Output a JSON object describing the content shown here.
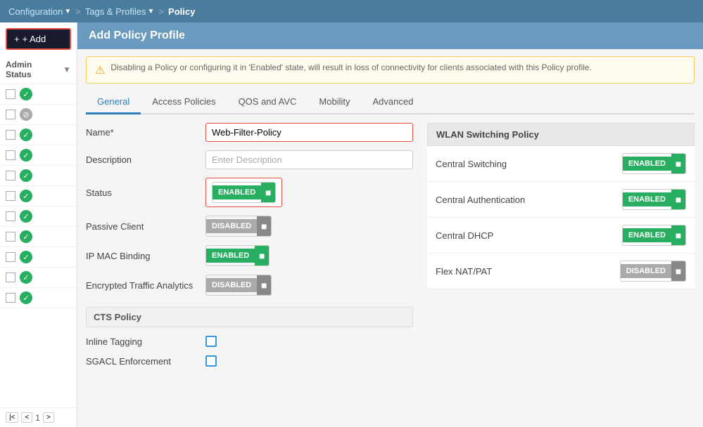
{
  "nav": {
    "config_label": "Configuration",
    "separator1": ">",
    "tags_label": "Tags & Profiles",
    "separator2": ">",
    "current": "Policy"
  },
  "sidebar": {
    "add_button": "+ Add",
    "admin_status_label": "Admin Status",
    "page_number": "1",
    "rows": [
      {
        "status": "green"
      },
      {
        "status": "grey"
      },
      {
        "status": "green"
      },
      {
        "status": "green"
      },
      {
        "status": "green"
      },
      {
        "status": "green"
      },
      {
        "status": "green"
      },
      {
        "status": "green"
      },
      {
        "status": "green"
      },
      {
        "status": "green"
      },
      {
        "status": "green"
      }
    ]
  },
  "content": {
    "header_title": "Add Policy Profile",
    "warning_text": "Disabling a Policy or configuring it in 'Enabled' state, will result in loss of connectivity for clients associated with this Policy profile.",
    "tabs": [
      {
        "label": "General",
        "active": true
      },
      {
        "label": "Access Policies",
        "active": false
      },
      {
        "label": "QOS and AVC",
        "active": false
      },
      {
        "label": "Mobility",
        "active": false
      },
      {
        "label": "Advanced",
        "active": false
      }
    ],
    "form": {
      "name_label": "Name*",
      "name_value": "Web-Filter-Policy",
      "description_label": "Description",
      "description_placeholder": "Enter Description",
      "status_label": "Status",
      "status_value": "ENABLED",
      "passive_client_label": "Passive Client",
      "passive_client_value": "DISABLED",
      "ip_mac_label": "IP MAC Binding",
      "ip_mac_value": "ENABLED",
      "encrypted_label": "Encrypted Traffic Analytics",
      "encrypted_value": "DISABLED",
      "cts_section_label": "CTS Policy",
      "inline_tagging_label": "Inline Tagging",
      "sgacl_label": "SGACL Enforcement"
    },
    "right_panel": {
      "title": "WLAN Switching Policy",
      "central_switching_label": "Central Switching",
      "central_switching_value": "ENABLED",
      "central_auth_label": "Central Authentication",
      "central_auth_value": "ENABLED",
      "central_dhcp_label": "Central DHCP",
      "central_dhcp_value": "ENABLED",
      "flex_nat_label": "Flex NAT/PAT",
      "flex_nat_value": "DISABLED"
    }
  }
}
